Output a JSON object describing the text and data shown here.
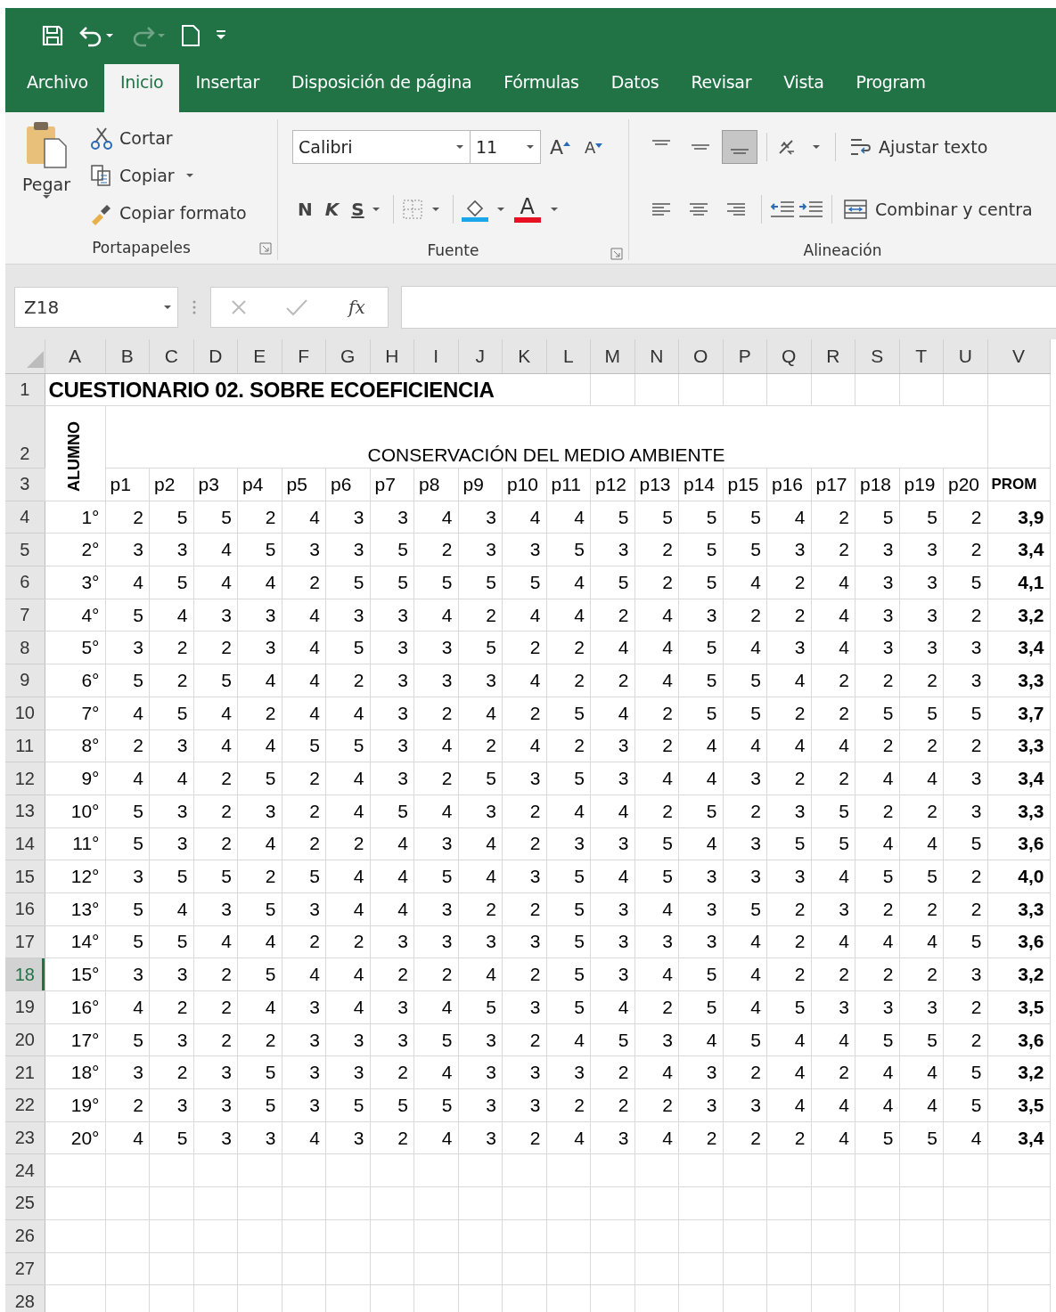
{
  "quick_access": [
    {
      "kind": "save",
      "disabled": false
    },
    {
      "kind": "undo",
      "disabled": false
    },
    {
      "kind": "redo",
      "disabled": true
    },
    {
      "kind": "new",
      "disabled": false
    },
    {
      "kind": "customize",
      "disabled": false
    }
  ],
  "tabs": [
    {
      "label": "Archivo",
      "selected": false
    },
    {
      "label": "Inicio",
      "selected": true
    },
    {
      "label": "Insertar",
      "selected": false
    },
    {
      "label": "Disposición de página",
      "selected": false
    },
    {
      "label": "Fórmulas",
      "selected": false
    },
    {
      "label": "Datos",
      "selected": false
    },
    {
      "label": "Revisar",
      "selected": false
    },
    {
      "label": "Vista",
      "selected": false
    },
    {
      "label": "Program",
      "selected": false
    }
  ],
  "clipboard": {
    "title": "Portapapeles",
    "paste": "Pegar",
    "cut": "Cortar",
    "copy": "Copiar",
    "format_painter": "Copiar formato"
  },
  "font": {
    "title": "Fuente",
    "name": "Calibri",
    "size": "11",
    "grow": "A",
    "shrink": "A",
    "bold": "N",
    "italic": "K",
    "underline": "S",
    "font_color": "A"
  },
  "alignment": {
    "title": "Alineación",
    "wrap_text": "Ajustar texto",
    "merge_center": "Combinar y centra",
    "vertical_buttons": [
      {
        "kind": "top",
        "selected": false
      },
      {
        "kind": "middle",
        "selected": false
      },
      {
        "kind": "bottom",
        "selected": true
      }
    ],
    "horizontal_buttons": [
      {
        "kind": "left",
        "selected": false
      },
      {
        "kind": "center",
        "selected": false
      },
      {
        "kind": "right",
        "selected": false
      }
    ]
  },
  "formula_bar": {
    "name_box": "Z18",
    "function_label": "fx"
  },
  "sheet": {
    "columns": [
      "A",
      "B",
      "C",
      "D",
      "E",
      "F",
      "G",
      "H",
      "I",
      "J",
      "K",
      "L",
      "M",
      "N",
      "O",
      "P",
      "Q",
      "R",
      "S",
      "T",
      "U",
      "V"
    ],
    "title_row": {
      "number": "1",
      "selected": false,
      "text": "CUESTIONARIO 02. SOBRE ECOEFICIENCIA"
    },
    "section_row": {
      "number": "2",
      "selected": false,
      "text": "CONSERVACIÓN DEL MEDIO AMBIENTE"
    },
    "header_row": {
      "number": "3",
      "selected": false,
      "student_label": "ALUMNO",
      "questions": [
        "p1",
        "p2",
        "p3",
        "p4",
        "p5",
        "p6",
        "p7",
        "p8",
        "p9",
        "p10",
        "p11",
        "p12",
        "p13",
        "p14",
        "p15",
        "p16",
        "p17",
        "p18",
        "p19",
        "p20"
      ],
      "average_label": "PROM"
    },
    "rows": [
      {
        "number": "4",
        "selected": false,
        "student": "1°",
        "answers": [
          "2",
          "5",
          "5",
          "2",
          "4",
          "3",
          "3",
          "4",
          "3",
          "4",
          "4",
          "5",
          "5",
          "5",
          "5",
          "4",
          "2",
          "5",
          "5",
          "2"
        ],
        "average": "3,9"
      },
      {
        "number": "5",
        "selected": false,
        "student": "2°",
        "answers": [
          "3",
          "3",
          "4",
          "5",
          "3",
          "3",
          "5",
          "2",
          "3",
          "3",
          "5",
          "3",
          "2",
          "5",
          "5",
          "3",
          "2",
          "3",
          "3",
          "2"
        ],
        "average": "3,4"
      },
      {
        "number": "6",
        "selected": false,
        "student": "3°",
        "answers": [
          "4",
          "5",
          "4",
          "4",
          "2",
          "5",
          "5",
          "5",
          "5",
          "5",
          "4",
          "5",
          "2",
          "5",
          "4",
          "2",
          "4",
          "3",
          "3",
          "5"
        ],
        "average": "4,1"
      },
      {
        "number": "7",
        "selected": false,
        "student": "4°",
        "answers": [
          "5",
          "4",
          "3",
          "3",
          "4",
          "3",
          "3",
          "4",
          "2",
          "4",
          "4",
          "2",
          "4",
          "3",
          "2",
          "2",
          "4",
          "3",
          "3",
          "2"
        ],
        "average": "3,2"
      },
      {
        "number": "8",
        "selected": false,
        "student": "5°",
        "answers": [
          "3",
          "2",
          "2",
          "3",
          "4",
          "5",
          "3",
          "3",
          "5",
          "2",
          "2",
          "4",
          "4",
          "5",
          "4",
          "3",
          "4",
          "3",
          "3",
          "3"
        ],
        "average": "3,4"
      },
      {
        "number": "9",
        "selected": false,
        "student": "6°",
        "answers": [
          "5",
          "2",
          "5",
          "4",
          "4",
          "2",
          "3",
          "3",
          "3",
          "4",
          "2",
          "2",
          "4",
          "5",
          "5",
          "4",
          "2",
          "2",
          "2",
          "3"
        ],
        "average": "3,3"
      },
      {
        "number": "10",
        "selected": false,
        "student": "7°",
        "answers": [
          "4",
          "5",
          "4",
          "2",
          "4",
          "4",
          "3",
          "2",
          "4",
          "2",
          "5",
          "4",
          "2",
          "5",
          "5",
          "2",
          "2",
          "5",
          "5",
          "5"
        ],
        "average": "3,7"
      },
      {
        "number": "11",
        "selected": false,
        "student": "8°",
        "answers": [
          "2",
          "3",
          "4",
          "4",
          "5",
          "5",
          "3",
          "4",
          "2",
          "4",
          "2",
          "3",
          "2",
          "4",
          "4",
          "4",
          "4",
          "2",
          "2",
          "2"
        ],
        "average": "3,3"
      },
      {
        "number": "12",
        "selected": false,
        "student": "9°",
        "answers": [
          "4",
          "4",
          "2",
          "5",
          "2",
          "4",
          "3",
          "2",
          "5",
          "3",
          "5",
          "3",
          "4",
          "4",
          "3",
          "2",
          "2",
          "4",
          "4",
          "3"
        ],
        "average": "3,4"
      },
      {
        "number": "13",
        "selected": false,
        "student": "10°",
        "answers": [
          "5",
          "3",
          "2",
          "3",
          "2",
          "4",
          "5",
          "4",
          "3",
          "2",
          "4",
          "4",
          "2",
          "5",
          "2",
          "3",
          "5",
          "2",
          "2",
          "3"
        ],
        "average": "3,3"
      },
      {
        "number": "14",
        "selected": false,
        "student": "11°",
        "answers": [
          "5",
          "3",
          "2",
          "4",
          "2",
          "2",
          "4",
          "3",
          "4",
          "2",
          "3",
          "3",
          "5",
          "4",
          "3",
          "5",
          "5",
          "4",
          "4",
          "5"
        ],
        "average": "3,6"
      },
      {
        "number": "15",
        "selected": false,
        "student": "12°",
        "answers": [
          "3",
          "5",
          "5",
          "2",
          "5",
          "4",
          "4",
          "5",
          "4",
          "3",
          "5",
          "4",
          "5",
          "3",
          "3",
          "3",
          "4",
          "5",
          "5",
          "2"
        ],
        "average": "4,0"
      },
      {
        "number": "16",
        "selected": false,
        "student": "13°",
        "answers": [
          "5",
          "4",
          "3",
          "5",
          "3",
          "4",
          "4",
          "3",
          "2",
          "2",
          "5",
          "3",
          "4",
          "3",
          "5",
          "2",
          "3",
          "2",
          "2",
          "2"
        ],
        "average": "3,3"
      },
      {
        "number": "17",
        "selected": false,
        "student": "14°",
        "answers": [
          "5",
          "5",
          "4",
          "4",
          "2",
          "2",
          "3",
          "3",
          "3",
          "3",
          "5",
          "3",
          "3",
          "3",
          "4",
          "2",
          "4",
          "4",
          "4",
          "5"
        ],
        "average": "3,6"
      },
      {
        "number": "18",
        "selected": true,
        "student": "15°",
        "answers": [
          "3",
          "3",
          "2",
          "5",
          "4",
          "4",
          "2",
          "2",
          "4",
          "2",
          "5",
          "3",
          "4",
          "5",
          "4",
          "2",
          "2",
          "2",
          "2",
          "3"
        ],
        "average": "3,2"
      },
      {
        "number": "19",
        "selected": false,
        "student": "16°",
        "answers": [
          "4",
          "2",
          "2",
          "4",
          "3",
          "4",
          "3",
          "4",
          "5",
          "3",
          "5",
          "4",
          "2",
          "5",
          "4",
          "5",
          "3",
          "3",
          "3",
          "2"
        ],
        "average": "3,5"
      },
      {
        "number": "20",
        "selected": false,
        "student": "17°",
        "answers": [
          "5",
          "3",
          "2",
          "2",
          "3",
          "3",
          "3",
          "5",
          "3",
          "2",
          "4",
          "5",
          "3",
          "4",
          "5",
          "4",
          "4",
          "5",
          "5",
          "2"
        ],
        "average": "3,6"
      },
      {
        "number": "21",
        "selected": false,
        "student": "18°",
        "answers": [
          "3",
          "2",
          "3",
          "5",
          "3",
          "3",
          "2",
          "4",
          "3",
          "3",
          "3",
          "2",
          "4",
          "3",
          "2",
          "4",
          "2",
          "4",
          "4",
          "5"
        ],
        "average": "3,2"
      },
      {
        "number": "22",
        "selected": false,
        "student": "19°",
        "answers": [
          "2",
          "3",
          "3",
          "5",
          "3",
          "5",
          "5",
          "5",
          "3",
          "3",
          "2",
          "2",
          "2",
          "3",
          "3",
          "4",
          "4",
          "4",
          "4",
          "5"
        ],
        "average": "3,5"
      },
      {
        "number": "23",
        "selected": false,
        "student": "20°",
        "answers": [
          "4",
          "5",
          "3",
          "3",
          "4",
          "3",
          "2",
          "4",
          "3",
          "2",
          "4",
          "3",
          "4",
          "2",
          "2",
          "2",
          "4",
          "5",
          "5",
          "4"
        ],
        "average": "3,4"
      }
    ],
    "empty_rows": [
      {
        "number": "24",
        "selected": false
      },
      {
        "number": "25",
        "selected": false
      },
      {
        "number": "26",
        "selected": false
      },
      {
        "number": "27",
        "selected": false
      },
      {
        "number": "28",
        "selected": false
      }
    ]
  }
}
